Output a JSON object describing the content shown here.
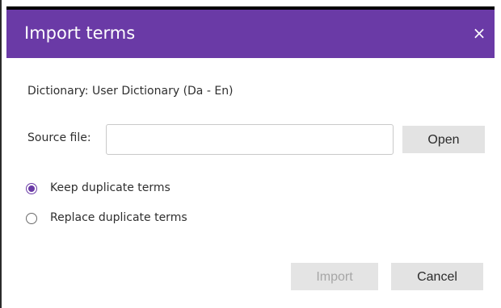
{
  "dialog": {
    "title": "Import terms",
    "close_symbol": "×",
    "title_bar_color": "#6a3aa6"
  },
  "dictionary": {
    "text": "Dictionary: User Dictionary (Da - En)"
  },
  "source_file": {
    "label": "Source file:",
    "value": "",
    "open_label": "Open"
  },
  "options": {
    "keep_label": "Keep duplicate terms",
    "replace_label": "Replace duplicate terms",
    "selected": "keep"
  },
  "buttons": {
    "import_label": "Import",
    "import_enabled": false,
    "cancel_label": "Cancel"
  }
}
